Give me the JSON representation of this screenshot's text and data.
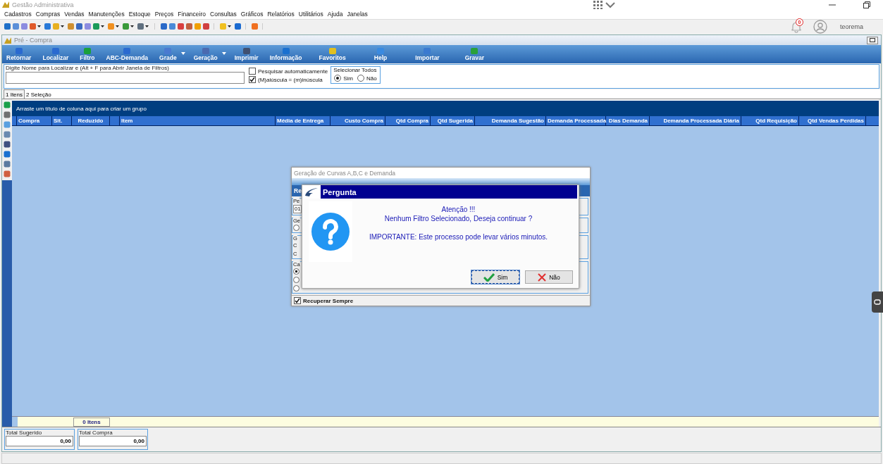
{
  "app": {
    "title": "Gestão Administrativa",
    "notifications": "0",
    "user": "teorema"
  },
  "menu": [
    "Cadastros",
    "Compras",
    "Vendas",
    "Manutenções",
    "Estoque",
    "Preços",
    "Financeiro",
    "Consultas",
    "Gráficos",
    "Relatórios",
    "Utilitários",
    "Ajuda",
    "Janelas"
  ],
  "toolbar": [
    [
      {
        "dropdown": false
      },
      {
        "dropdown": false
      },
      {
        "dropdown": false
      },
      {
        "dropdown": true
      },
      {
        "dropdown": false
      },
      {
        "dropdown": true
      },
      {
        "dropdown": false
      },
      {
        "dropdown": false
      },
      {
        "dropdown": false
      },
      {
        "dropdown": true
      },
      {
        "dropdown": true
      },
      {
        "dropdown": true
      },
      {
        "dropdown": true
      }
    ],
    [
      {
        "dropdown": false
      },
      {
        "dropdown": false
      },
      {
        "dropdown": false
      },
      {
        "dropdown": false
      },
      {
        "dropdown": false
      },
      {
        "dropdown": false
      }
    ],
    [
      {
        "dropdown": true
      },
      {
        "dropdown": false
      }
    ],
    [
      {
        "dropdown": false
      }
    ]
  ],
  "window": {
    "title": "Pré - Compra"
  },
  "ribbon": [
    {
      "label": "Retornar",
      "dropdown": false
    },
    {
      "label": "Localizar",
      "dropdown": false
    },
    {
      "label": "Filtro",
      "dropdown": false
    },
    {
      "label": "ABC-Demanda",
      "dropdown": false
    },
    {
      "label": "Grade",
      "dropdown": true
    },
    {
      "label": "Geração",
      "dropdown": true
    },
    {
      "label": "Imprimir",
      "dropdown": false
    },
    {
      "label": "Informação",
      "dropdown": false
    },
    {
      "label": "Favoritos",
      "dropdown": false
    },
    {
      "label": "Help",
      "dropdown": false
    },
    {
      "label": "Importar",
      "dropdown": false
    },
    {
      "label": "Gravar",
      "dropdown": false
    }
  ],
  "filter": {
    "legend": "Digite Nome para Localizar e (Alt + F para Abrir Janela de Filtros)",
    "checkboxes": [
      {
        "label": "Pesquisar automaticamente",
        "checked": false
      },
      {
        "label": "(M)aiúscula = (m)inúscula",
        "checked": true
      }
    ],
    "select_all": {
      "legend": "Selecionar Todos",
      "options": [
        {
          "label": "Sim",
          "selected": true
        },
        {
          "label": "Não",
          "selected": false
        }
      ]
    }
  },
  "tabs": [
    {
      "label": "1 Itens",
      "selected": true
    },
    {
      "label": "2 Seleção",
      "selected": false
    }
  ],
  "grid": {
    "group_hint": "Arraste um título de coluna aqui para criar um grupo",
    "columns": [
      "Compra",
      "Sit.",
      "Reduzido",
      "",
      "Item",
      "Média de Entrega",
      "Custo Compra",
      "Qtd Compra",
      "Qtd Sugerida",
      "Demanda Sugestão",
      "Demanda Processada",
      "Dias Demanda",
      "Demanda Processada Diária",
      "Qtd Requisição",
      "Qtd Vendas Perdidas"
    ],
    "footer": "0 Itens"
  },
  "totals": [
    {
      "label": "Total Sugerido",
      "value": "0,00"
    },
    {
      "label": "Total Compra",
      "value": "0,00"
    }
  ],
  "background_dialog": {
    "title": "Geração de Curvas A,B,C e Demanda",
    "tab": "Re",
    "groups": [
      {
        "legend": "Pe",
        "field": "01"
      },
      {
        "legend": "Ge",
        "radios": [
          {
            "selected": false
          }
        ]
      },
      {
        "legend": "G",
        "options": [
          "C",
          "C"
        ]
      },
      {
        "legend": "Ca",
        "radios": [
          {
            "selected": true
          },
          {
            "selected": false
          },
          {
            "selected": false
          }
        ]
      }
    ],
    "checkbox": {
      "label": "Recuperar Sempre",
      "checked": true
    }
  },
  "message": {
    "title": "Pergunta",
    "lines": [
      "Atenção !!!",
      "Nenhum Filtro Selecionado, Deseja continuar ?",
      "IMPORTANTE: Este processo pode levar vários minutos."
    ],
    "buttons": [
      {
        "label": "Sim",
        "kind": "confirm",
        "focused": true
      },
      {
        "label": "Não",
        "kind": "cancel",
        "focused": false
      }
    ]
  }
}
